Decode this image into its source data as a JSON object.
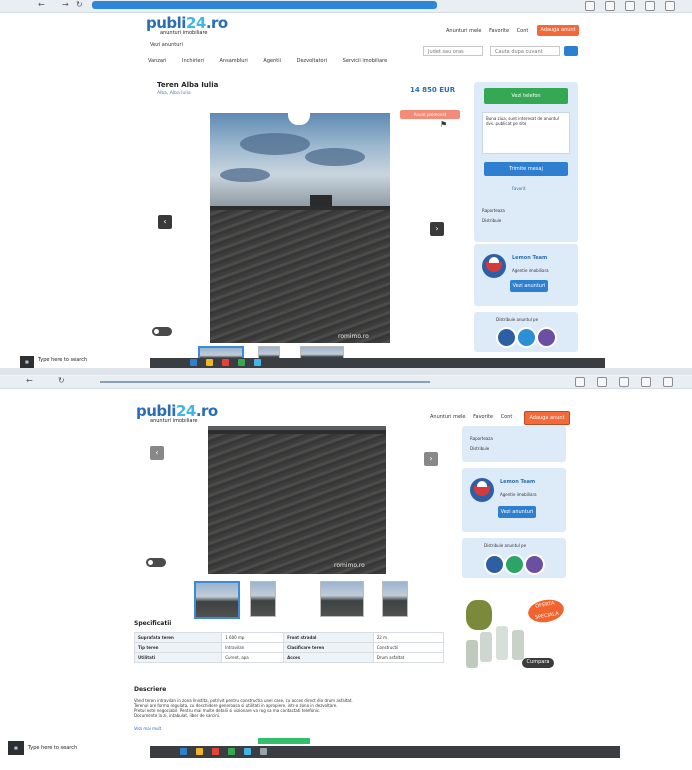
{
  "site": {
    "logo_main": "publi",
    "logo_accent": "24",
    "logo_tld": ".ro",
    "logo_tagline": "anunturi imobiliare",
    "top_links": [
      "Anunturi mele",
      "Favorite",
      "Cont"
    ],
    "add_button": "Adauga anunt",
    "breadcrumb": "Vezi anunturi",
    "menu": [
      "Vanzari",
      "Inchirieri",
      "Ansambluri",
      "Agentii",
      "Dezvoltatori",
      "Servicii imobiliare"
    ],
    "search_location_placeholder": "Judet sau oras",
    "search_keyword_placeholder": "Cauta dupa cuvant"
  },
  "listing": {
    "title": "Teren Alba Iulia",
    "location": "Alba, Alba Iulia",
    "price": "14 850 EUR",
    "badge": "Anunt promovat",
    "watermark": "romimo.ro"
  },
  "sidebar": {
    "contact_button": "Vezi telefon",
    "message_hint": "Buna ziua, sunt interesat de anuntul dvs. publicat pe site",
    "send_button": "Trimite mesaj",
    "favorite_link": "Favorit",
    "report_link": "Raporteaza",
    "share_link": "Distribuie",
    "agency_name": "Lemon Team",
    "agency_sub": "Agentie imobiliara",
    "agency_button": "Vezi anunturi",
    "share_label": "Distribuie anuntul pe"
  },
  "specs": {
    "title": "Specificatii",
    "rows": [
      [
        "Suprafata teren",
        "1 600 mp",
        "Front stradal",
        "22 m"
      ],
      [
        "Tip teren",
        "Intravilan",
        "Clasificare teren",
        "Constructii"
      ],
      [
        "Utilitati",
        "Curent, apa",
        "Acces",
        "Drum asfaltat"
      ]
    ]
  },
  "description": {
    "title": "Descriere",
    "lines": [
      "Vand teren intravilan in zona linistita, potrivit pentru constructia unei case, cu acces direct din drum asfaltat.",
      "Terenul are forma regulata, cu deschidere generoasa si utilitati in apropiere, intr-o zona in dezvoltare.",
      "Pretul este negociabil. Pentru mai multe detalii si vizionare va rog sa ma contactati telefonic.",
      "Documente la zi, intabulat, liber de sarcini."
    ],
    "more_link": "Vezi mai mult"
  },
  "ad": {
    "badge_line1": "OFERTA",
    "badge_line2": "SPECIALA",
    "button": "Cumpara"
  },
  "taskbar": {
    "search_text": "Type here to search"
  },
  "colors": {
    "brand_blue": "#2a6fb5",
    "accent_orange": "#f36a3a",
    "contact_green": "#34a853",
    "sidebar_bg": "#ddeaf7"
  }
}
